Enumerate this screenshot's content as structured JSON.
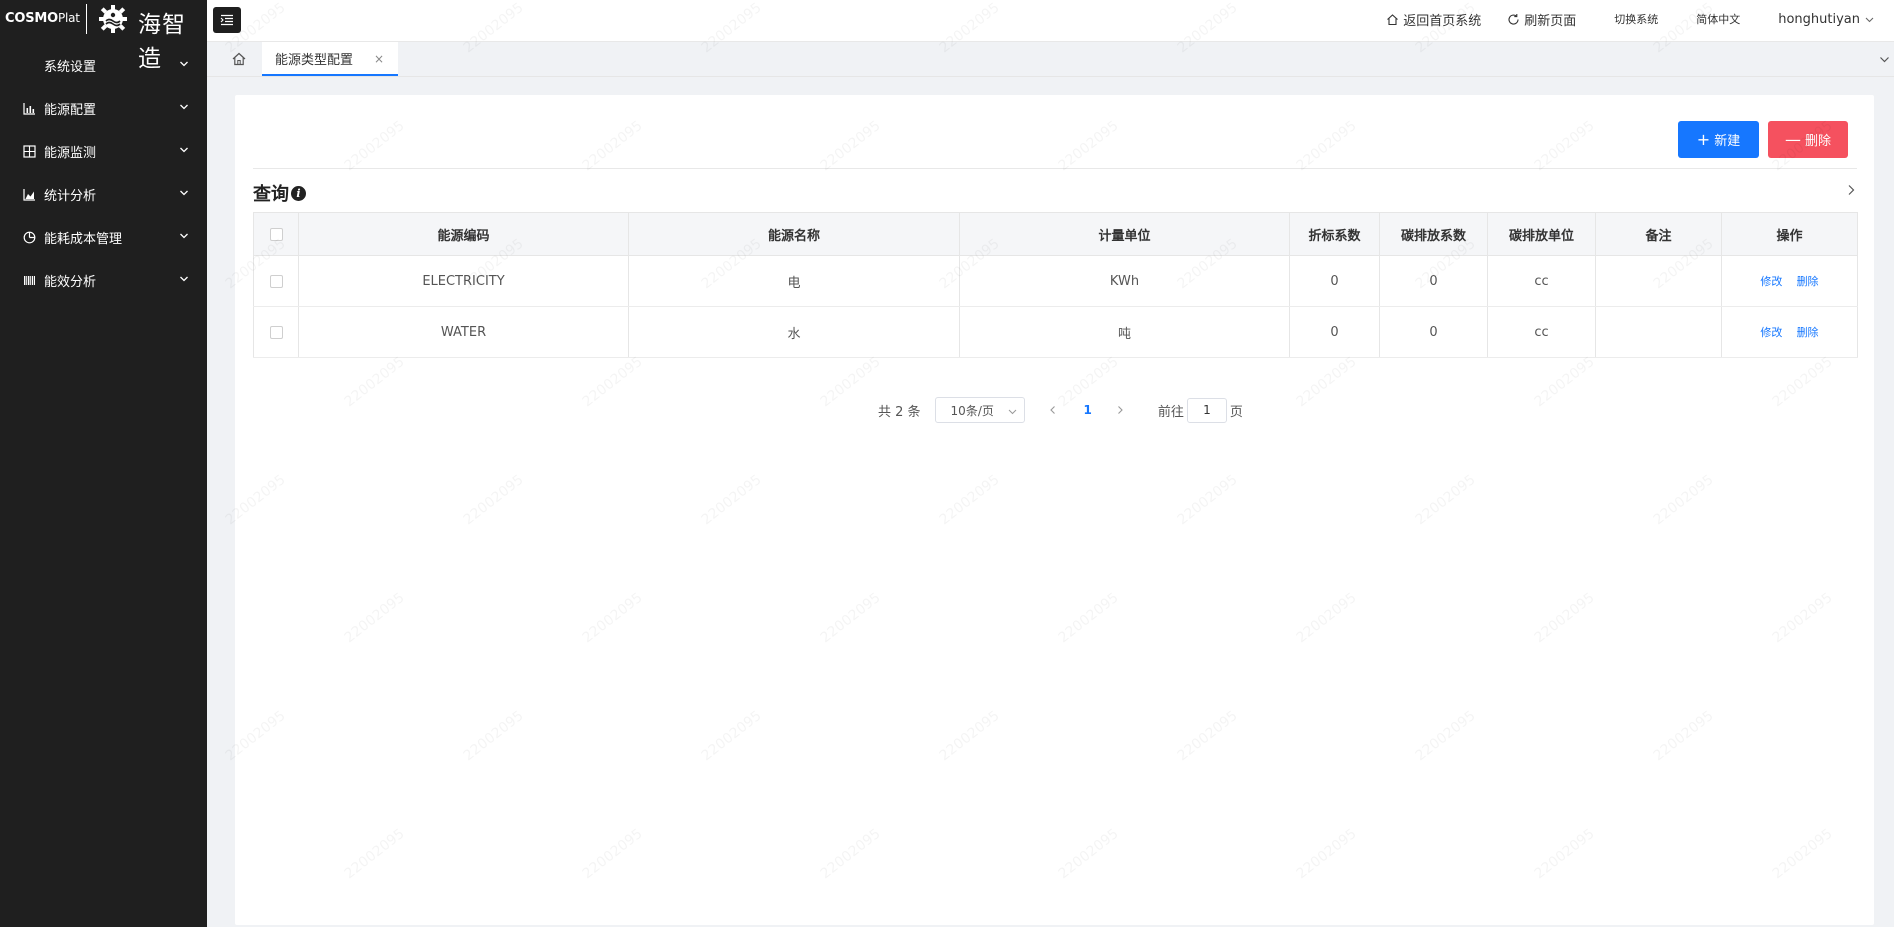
{
  "logo": {
    "cosmo": "COSMO",
    "plat": "Plat",
    "cn": "海智造"
  },
  "sidebar": {
    "items": [
      {
        "label": "系统设置",
        "icon": "none"
      },
      {
        "label": "能源配置",
        "icon": "bar-chart-icon"
      },
      {
        "label": "能源监测",
        "icon": "grid-panel-icon"
      },
      {
        "label": "统计分析",
        "icon": "area-chart-icon"
      },
      {
        "label": "能耗成本管理",
        "icon": "pie-chart-icon"
      },
      {
        "label": "能效分析",
        "icon": "barcode-icon"
      }
    ]
  },
  "header": {
    "back_home": "返回首页系统",
    "refresh": "刷新页面",
    "switch_system": "切换系统",
    "language": "简体中文",
    "user": "honghutiyan"
  },
  "tabs": {
    "active": "能源类型配置",
    "close": "×"
  },
  "toolbar": {
    "new_label": "新建",
    "new_symbol": "+",
    "delete_label": "删除",
    "delete_symbol": "—"
  },
  "query": {
    "title": "查询",
    "info": "i"
  },
  "table": {
    "columns": [
      "能源编码",
      "能源名称",
      "计量单位",
      "折标系数",
      "碳排放系数",
      "碳排放单位",
      "备注",
      "操作"
    ],
    "rows": [
      {
        "code": "ELECTRICITY",
        "name": "电",
        "unit": "KWh",
        "std_coef": "0",
        "carbon_coef": "0",
        "carbon_unit": "cc",
        "remark": "",
        "edit": "修改",
        "delete": "删除"
      },
      {
        "code": "WATER",
        "name": "水",
        "unit": "吨",
        "std_coef": "0",
        "carbon_coef": "0",
        "carbon_unit": "cc",
        "remark": "",
        "edit": "修改",
        "delete": "删除"
      }
    ]
  },
  "pagination": {
    "total": "共 2 条",
    "page_size": "10条/页",
    "current_page": "1",
    "goto_label": "前往",
    "goto_value": "1",
    "page_suffix": "页"
  },
  "watermark": "22002095",
  "colors": {
    "sidebar_bg": "#1f1f1f",
    "primary": "#1677ff",
    "danger": "#f5515f"
  }
}
